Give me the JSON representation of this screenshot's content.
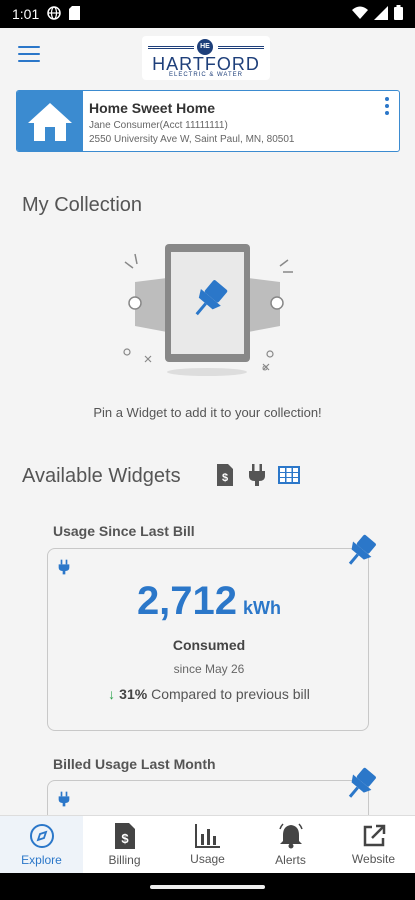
{
  "status_bar": {
    "time": "1:01"
  },
  "header": {
    "logo_name": "HARTFORD",
    "logo_sub": "ELECTRIC & WATER",
    "logo_mark": "HE"
  },
  "account": {
    "name": "Home Sweet Home",
    "holder": "Jane Consumer(Acct 11111111)",
    "address": "2550 University Ave W, Saint Paul, MN, 80501"
  },
  "collection": {
    "title": "My Collection",
    "empty_message": "Pin a Widget to add it to your collection!"
  },
  "widgets_section": {
    "title": "Available Widgets",
    "filters": [
      "billing-filter-icon",
      "electric-filter-icon",
      "grid-view-icon"
    ]
  },
  "widgets": [
    {
      "title": "Usage Since Last Bill",
      "value": "2,712",
      "unit": "kWh",
      "label": "Consumed",
      "since": "since May 26",
      "change_pct": "31%",
      "change_text": "Compared to previous bill"
    },
    {
      "title": "Billed Usage Last Month"
    }
  ],
  "nav": [
    {
      "label": "Explore",
      "icon": "compass-icon",
      "active": true
    },
    {
      "label": "Billing",
      "icon": "bill-icon",
      "active": false
    },
    {
      "label": "Usage",
      "icon": "bar-chart-icon",
      "active": false
    },
    {
      "label": "Alerts",
      "icon": "bell-icon",
      "active": false
    },
    {
      "label": "Website",
      "icon": "external-link-icon",
      "active": false
    }
  ],
  "colors": {
    "accent": "#2b77c9",
    "tile": "#3b8bd0",
    "down_arrow": "#2aa14a",
    "logo": "#1e3f7a"
  }
}
